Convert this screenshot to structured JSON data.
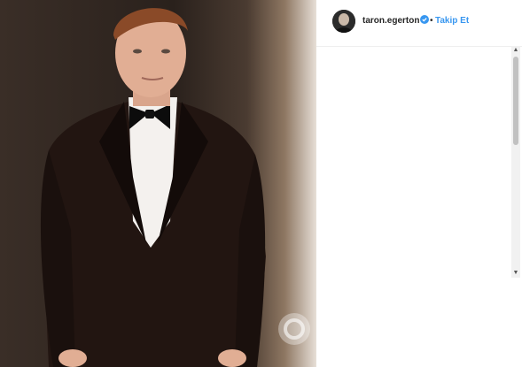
{
  "post": {
    "username": "taron.egerton",
    "separator": "•",
    "follow_label": "Takip Et"
  },
  "icons": {
    "verified": "verified-badge-icon",
    "scroll_up": "chevron-up-icon",
    "scroll_down": "chevron-down-icon",
    "watermark": "watermark-logo"
  },
  "colors": {
    "follow": "#3897f0",
    "verified": "#3897f0",
    "username": "#262626"
  }
}
